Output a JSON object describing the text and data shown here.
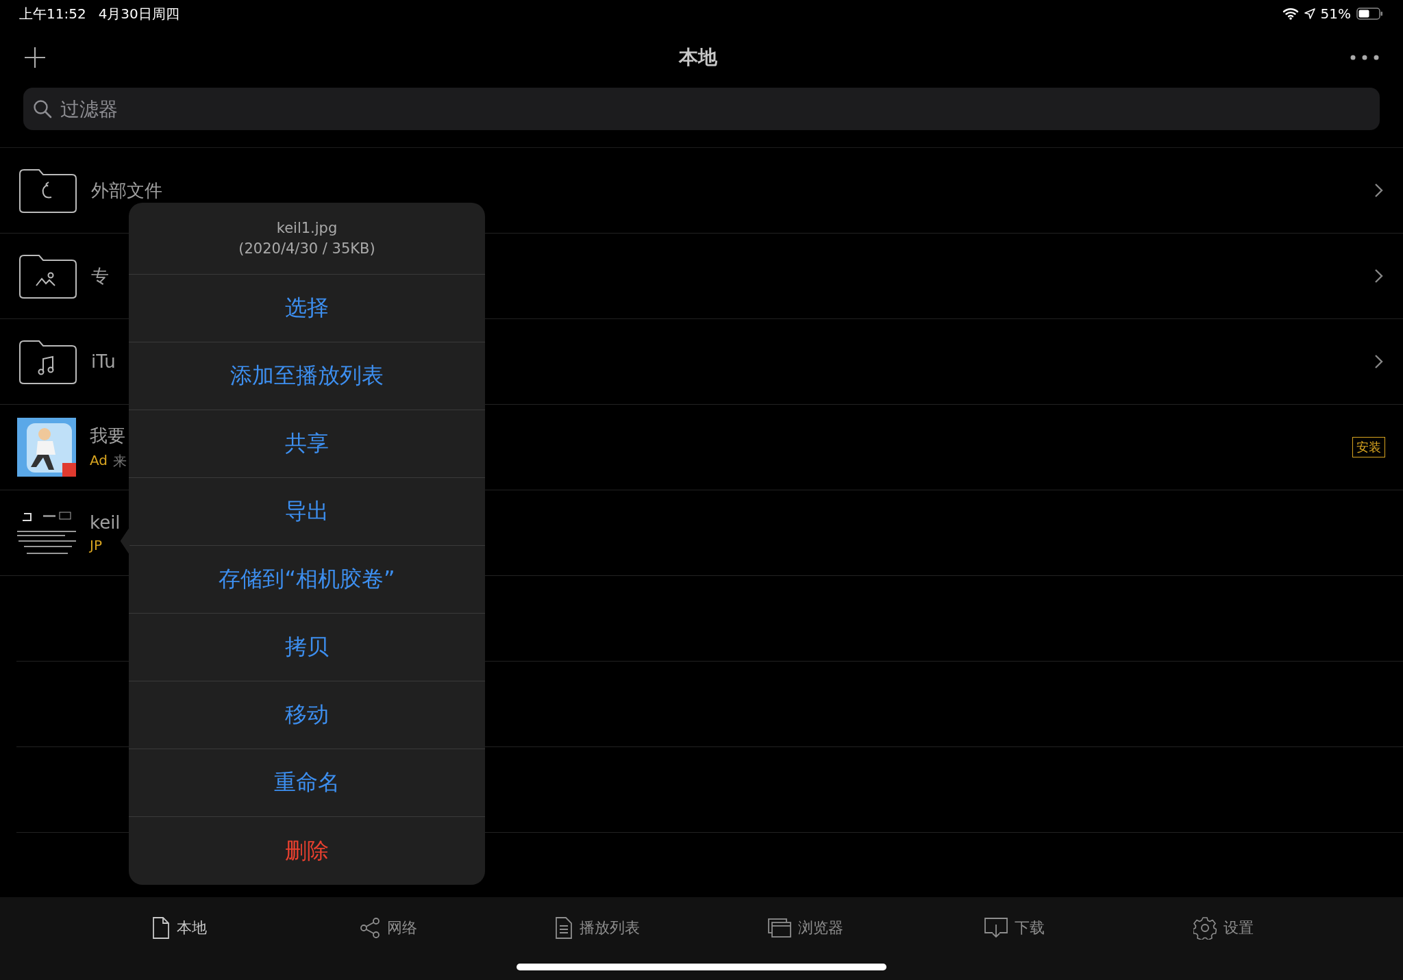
{
  "status_bar": {
    "time": "上午11:52",
    "date": "4月30日周四",
    "battery": "51%"
  },
  "nav_bar": {
    "title": "本地"
  },
  "search": {
    "placeholder": "过滤器"
  },
  "rows": [
    {
      "kind": "folder",
      "title": "外部文件"
    },
    {
      "kind": "folder",
      "title": "专"
    },
    {
      "kind": "folder",
      "title": "iTu"
    },
    {
      "kind": "ad",
      "title": "我要",
      "ad_tag": "Ad",
      "subtitle": "来",
      "action": "安装"
    },
    {
      "kind": "file",
      "title": "keil",
      "subtitle": "JP"
    }
  ],
  "popover": {
    "file_name": "keil1.jpg",
    "file_info": "(2020/4/30 / 35KB)",
    "items": [
      {
        "label": "选择",
        "kind": "default"
      },
      {
        "label": "添加至播放列表",
        "kind": "default"
      },
      {
        "label": "共享",
        "kind": "default"
      },
      {
        "label": "导出",
        "kind": "default"
      },
      {
        "label": "存储到“相机胶卷”",
        "kind": "default"
      },
      {
        "label": "拷贝",
        "kind": "default"
      },
      {
        "label": "移动",
        "kind": "default"
      },
      {
        "label": "重命名",
        "kind": "default"
      },
      {
        "label": "删除",
        "kind": "destructive"
      }
    ]
  },
  "tab_bar": [
    {
      "label": "本地",
      "selected": true
    },
    {
      "label": "网络",
      "selected": false
    },
    {
      "label": "播放列表",
      "selected": false
    },
    {
      "label": "浏览器",
      "selected": false
    },
    {
      "label": "下载",
      "selected": false
    },
    {
      "label": "设置",
      "selected": false
    }
  ]
}
